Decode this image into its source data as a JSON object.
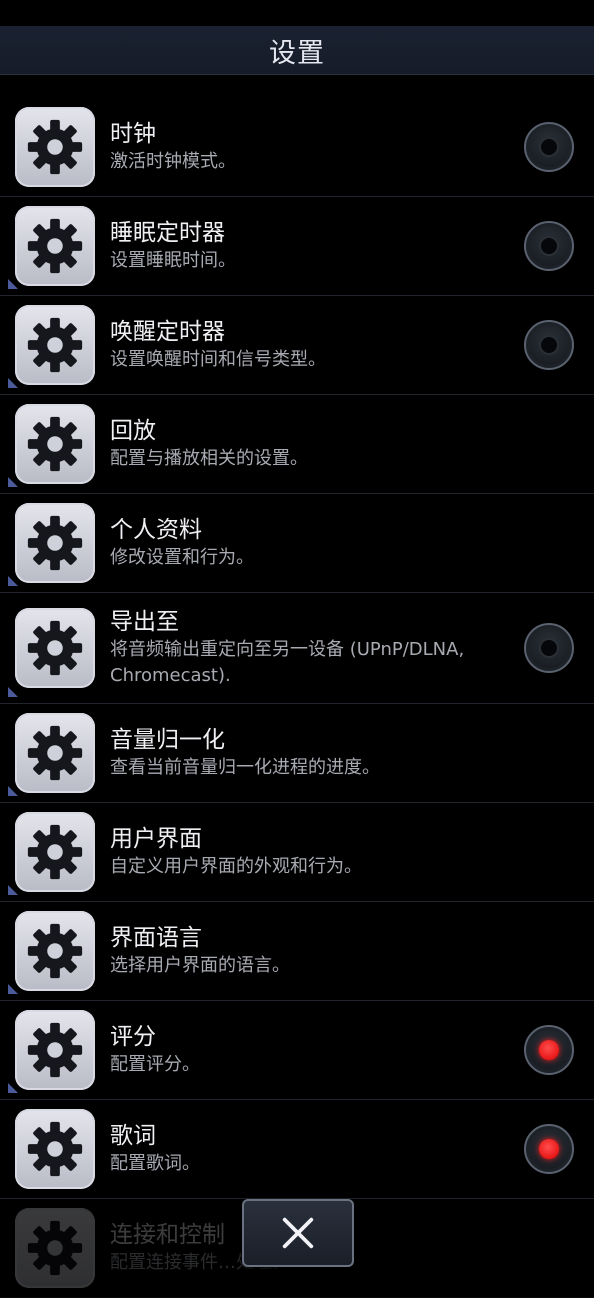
{
  "header": {
    "title": "设置"
  },
  "settings": [
    {
      "title": "时钟",
      "subtitle": "激活时钟模式。",
      "toggle": "off",
      "icon": "gear-icon"
    },
    {
      "title": "睡眠定时器",
      "subtitle": "设置睡眠时间。",
      "toggle": "off",
      "icon": "gear-icon"
    },
    {
      "title": "唤醒定时器",
      "subtitle": "设置唤醒时间和信号类型。",
      "toggle": "off",
      "icon": "gear-icon"
    },
    {
      "title": "回放",
      "subtitle": "配置与播放相关的设置。",
      "toggle": null,
      "icon": "gear-icon"
    },
    {
      "title": "个人资料",
      "subtitle": "修改设置和行为。",
      "toggle": null,
      "icon": "gear-icon"
    },
    {
      "title": "导出至",
      "subtitle": "将音频输出重定向至另一设备 (UPnP/DLNA, Chromecast).",
      "toggle": "off",
      "icon": "gear-icon"
    },
    {
      "title": "音量归一化",
      "subtitle": "查看当前音量归一化进程的进度。",
      "toggle": null,
      "icon": "gear-icon"
    },
    {
      "title": "用户界面",
      "subtitle": "自定义用户界面的外观和行为。",
      "toggle": null,
      "icon": "gear-icon"
    },
    {
      "title": "界面语言",
      "subtitle": "选择用户界面的语言。",
      "toggle": null,
      "icon": "gear-icon"
    },
    {
      "title": "评分",
      "subtitle": "配置评分。",
      "toggle": "on",
      "icon": "gear-icon"
    },
    {
      "title": "歌词",
      "subtitle": "配置歌词。",
      "toggle": "on",
      "icon": "gear-icon"
    },
    {
      "title": "连接和控制",
      "subtitle": "配置连接事件…处理。",
      "toggle": null,
      "icon": "gear-icon"
    }
  ],
  "close_button": {
    "icon": "close-icon"
  },
  "colors": {
    "background": "#000000",
    "title_bar": "#1a2130",
    "toggle_on": "#ff1a1a"
  }
}
